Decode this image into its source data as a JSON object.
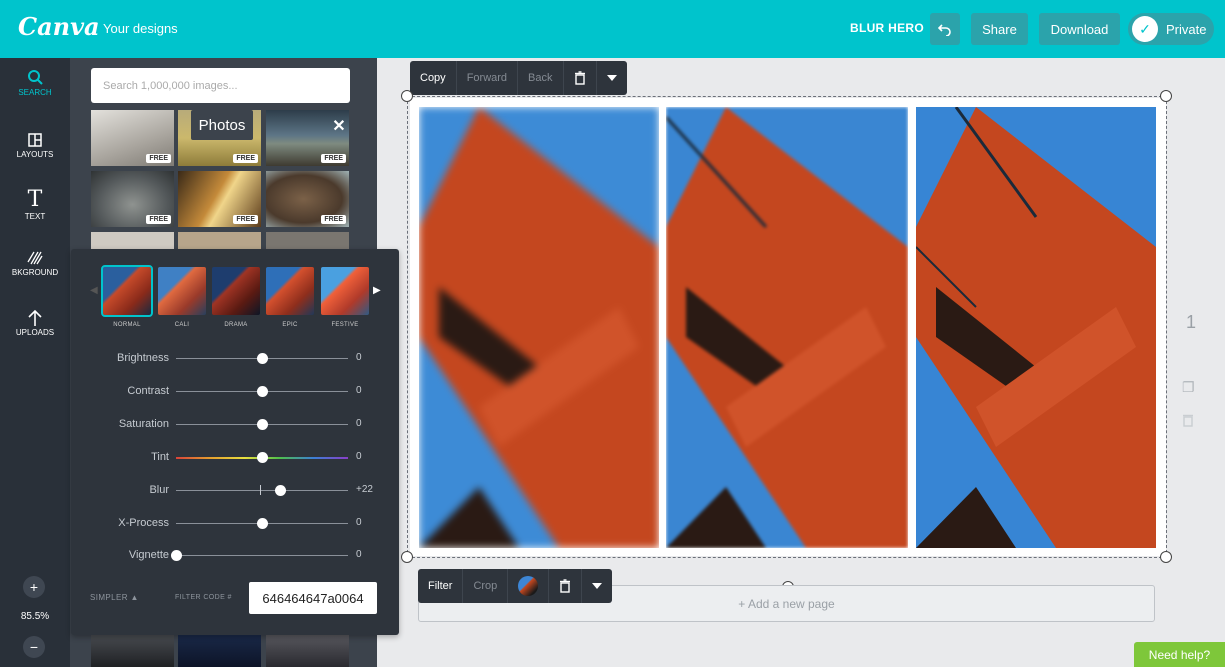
{
  "app": {
    "logo": "Canva",
    "your_designs": "Your designs"
  },
  "header": {
    "design_name": "BLUR HERO",
    "share_label": "Share",
    "download_label": "Download",
    "private_label": "Private"
  },
  "sidenav": {
    "items": [
      {
        "label": "SEARCH",
        "icon": "search-icon"
      },
      {
        "label": "LAYOUTS",
        "icon": "layouts-icon"
      },
      {
        "label": "TEXT",
        "icon": "text-icon"
      },
      {
        "label": "BKGROUND",
        "icon": "background-icon"
      },
      {
        "label": "UPLOADS",
        "icon": "upload-icon"
      }
    ],
    "zoom": "85.5%"
  },
  "library": {
    "search_placeholder": "Search 1,000,000 images...",
    "photos_tag": "Photos",
    "free_badge": "FREE"
  },
  "filters": {
    "presets": [
      "NORMAL",
      "CALI",
      "DRAMA",
      "EPIC",
      "FESTIVE"
    ],
    "sliders": [
      {
        "label": "Brightness",
        "value": "0",
        "level": 0
      },
      {
        "label": "Contrast",
        "value": "0",
        "level": 0
      },
      {
        "label": "Saturation",
        "value": "0",
        "level": 0
      },
      {
        "label": "Tint",
        "value": "0",
        "level": 0
      },
      {
        "label": "Blur",
        "value": "+22",
        "level": 22
      },
      {
        "label": "X-Process",
        "value": "0",
        "level": 0
      },
      {
        "label": "Vignette",
        "value": "0",
        "level": 0
      }
    ],
    "simpler_label": "SIMPLER ▲",
    "filter_code_label": "FILTER CODE #",
    "filter_code": "646464647a0064"
  },
  "top_toolbar": {
    "copy": "Copy",
    "forward": "Forward",
    "back": "Back"
  },
  "bottom_toolbar": {
    "filter": "Filter",
    "crop": "Crop"
  },
  "canvas": {
    "add_page": "+ Add a new page",
    "page_number": "1"
  },
  "help": {
    "label": "Need help?"
  },
  "colors": {
    "brand": "#00c4cc",
    "sidebar": "#293039",
    "panel": "#3c434c",
    "help": "#7ec73a"
  }
}
